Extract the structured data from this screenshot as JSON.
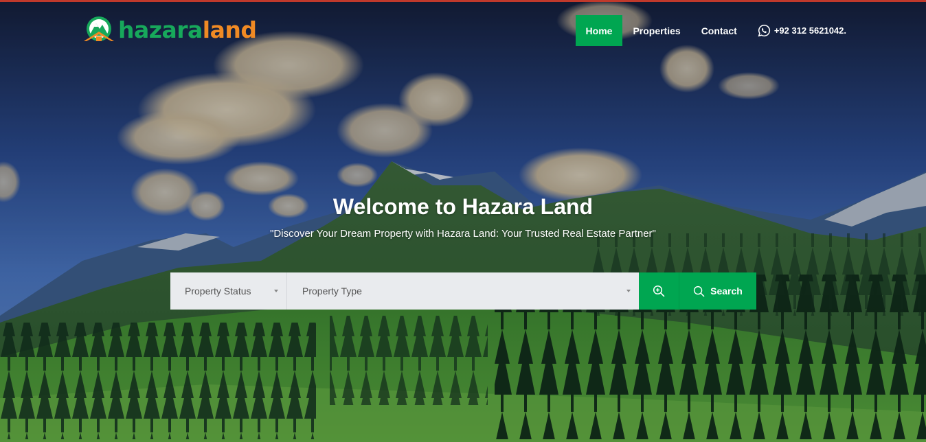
{
  "logo": {
    "part1": "hazara",
    "part2": "land",
    "icon": "mountain-house-logo-icon"
  },
  "nav": {
    "items": [
      {
        "label": "Home",
        "active": true
      },
      {
        "label": "Properties",
        "active": false
      },
      {
        "label": "Contact",
        "active": false
      }
    ],
    "phone": "+92 312 5621042.",
    "phone_icon": "whatsapp-icon"
  },
  "hero": {
    "title": "Welcome to Hazara Land",
    "subtitle": "\"Discover Your Dream Property with Hazara Land: Your Trusted Real Estate Partner\""
  },
  "search": {
    "status_placeholder": "Property Status",
    "type_placeholder": "Property Type",
    "advanced_icon": "zoom-in-icon",
    "search_label": "Search",
    "search_icon": "search-icon"
  },
  "colors": {
    "accent": "#00a651",
    "logo_green": "#17a85b",
    "logo_orange": "#f08a24",
    "top_strip": "#c0392b"
  }
}
